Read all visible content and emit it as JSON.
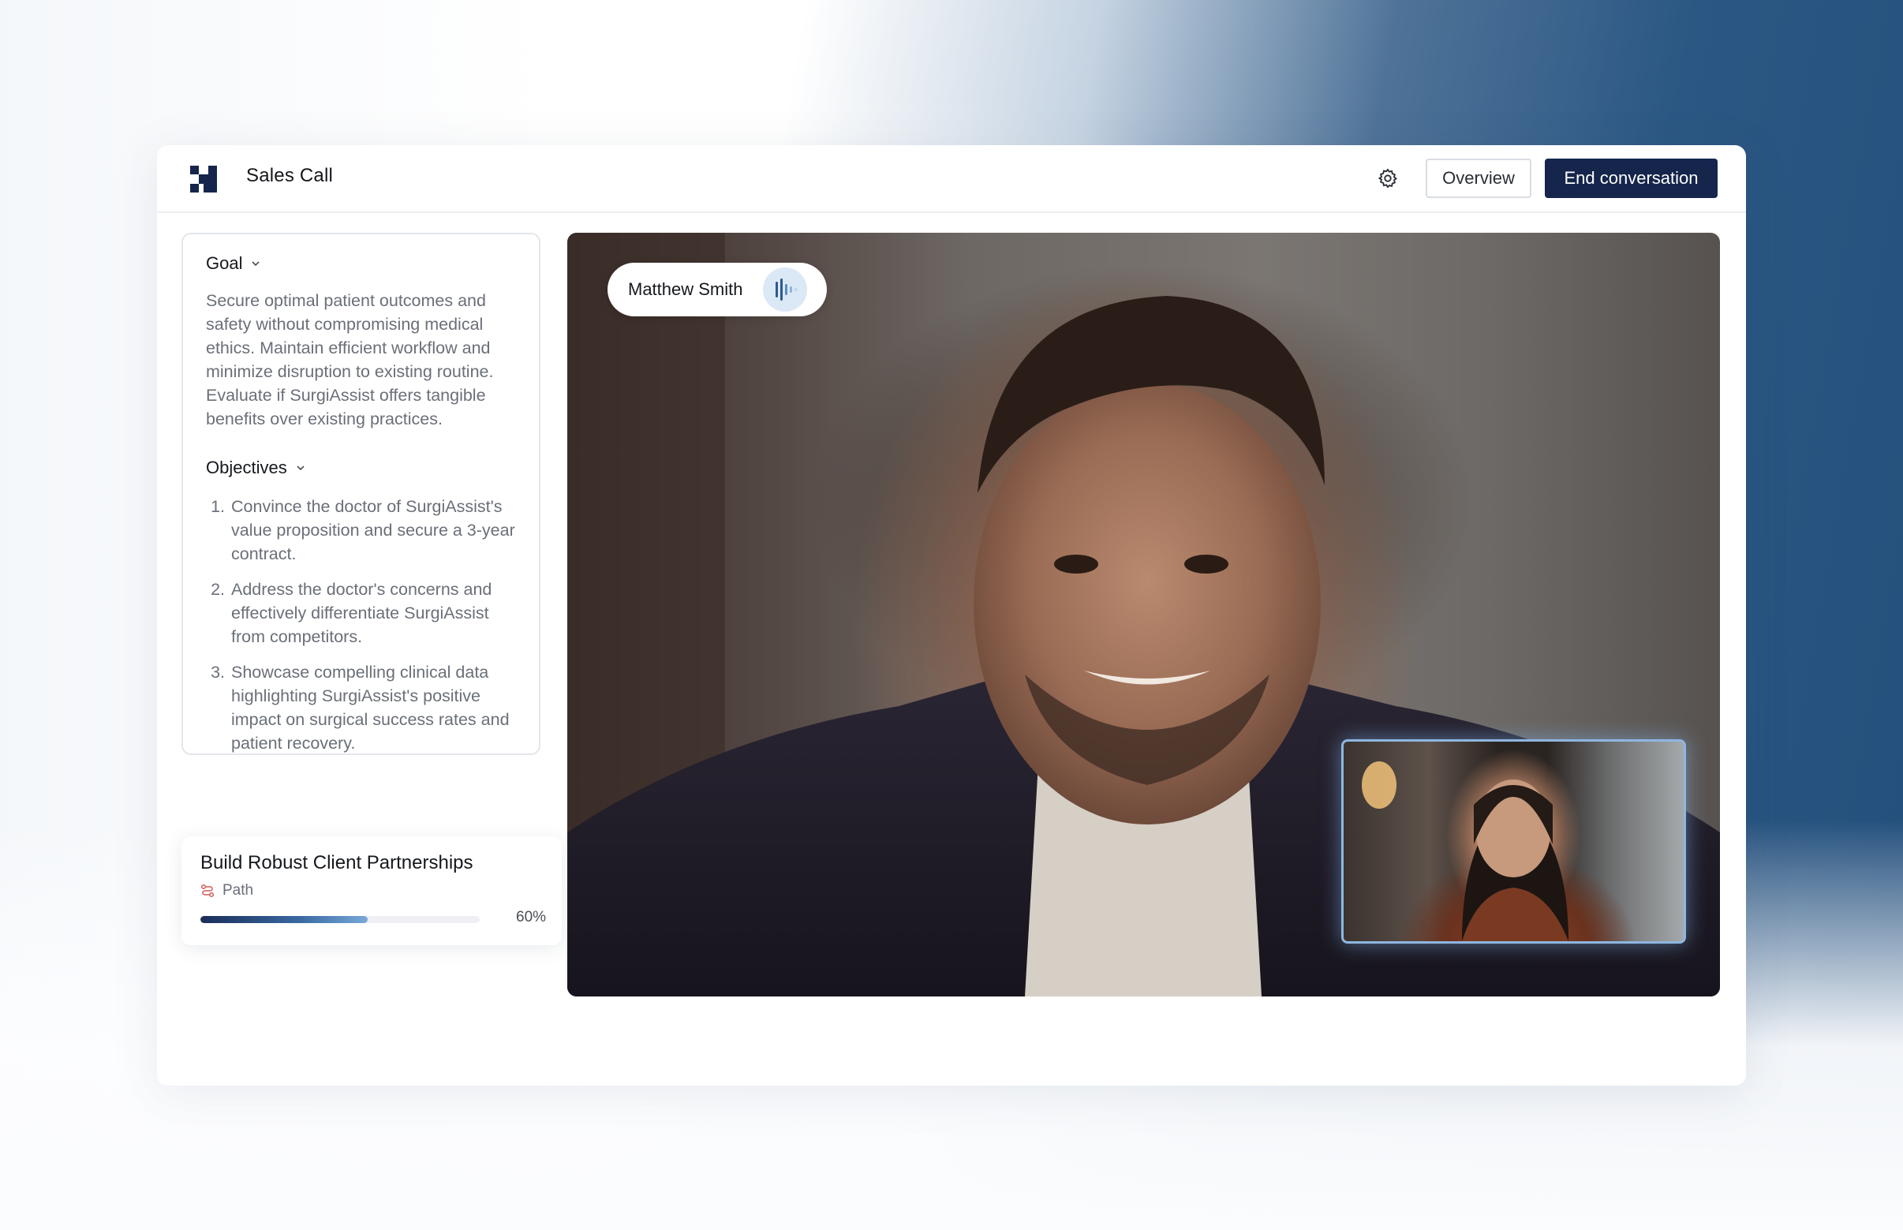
{
  "header": {
    "app_title": "Sales Call",
    "settings_icon": "gear-icon",
    "overview_label": "Overview",
    "end_label": "End conversation"
  },
  "colors": {
    "primary": "#15254b",
    "accent": "#3a6aa3",
    "text_muted": "#6a6f78"
  },
  "goal": {
    "heading": "Goal",
    "text": "Secure optimal patient outcomes and safety without compromising medical ethics. Maintain efficient workflow and minimize disruption to existing routine. Evaluate if SurgiAssist offers tangible benefits over existing practices."
  },
  "objectives": {
    "heading": "Objectives",
    "items": [
      {
        "num": "1.",
        "text": "Convince the doctor of SurgiAssist's value proposition and secure a 3-year contract."
      },
      {
        "num": "2.",
        "text": "Address the doctor's concerns and effectively differentiate SurgiAssist from competitors."
      },
      {
        "num": "3.",
        "text": "Showcase compelling clinical data highlighting SurgiAssist's positive impact on surgical success rates and patient recovery."
      }
    ]
  },
  "path_card": {
    "title": "Build Robust Client Partnerships",
    "subtitle": "Path",
    "icon": "route-icon",
    "progress": 60,
    "progress_label": "60%"
  },
  "video": {
    "participant_name": "Matthew Smith",
    "speaking_icon": "audio-wave-icon"
  }
}
